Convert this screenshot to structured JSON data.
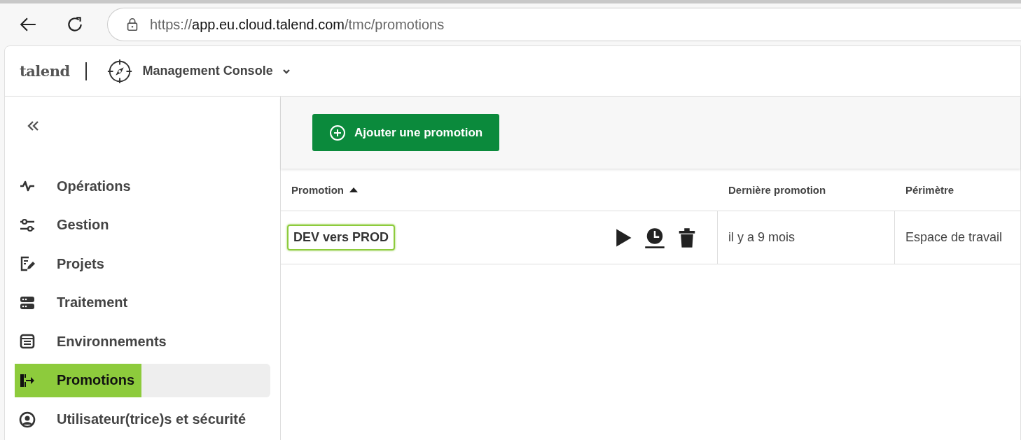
{
  "browser": {
    "url": {
      "scheme": "https://",
      "host": "app.eu.cloud.talend.com",
      "path": "/tmc/promotions"
    }
  },
  "header": {
    "logo": "talend",
    "app_name": "Management Console"
  },
  "sidebar": {
    "items": [
      {
        "label": "Opérations",
        "kind": "pulse",
        "selected": false
      },
      {
        "label": "Gestion",
        "kind": "sliders",
        "selected": false
      },
      {
        "label": "Projets",
        "kind": "edit",
        "selected": false
      },
      {
        "label": "Traitement",
        "kind": "server",
        "selected": false
      },
      {
        "label": "Environnements",
        "kind": "box",
        "selected": false
      },
      {
        "label": "Promotions",
        "kind": "promote",
        "selected": true
      },
      {
        "label": "Utilisateur(trice)s et sécurité",
        "kind": "user",
        "selected": false
      }
    ]
  },
  "toolbar": {
    "add_button": "Ajouter une promotion"
  },
  "table": {
    "columns": [
      {
        "label": "Promotion",
        "sorted": true
      },
      {
        "label": "Dernière promotion",
        "sorted": false
      },
      {
        "label": "Périmètre",
        "sorted": false
      }
    ],
    "rows": [
      {
        "name": "DEV vers PROD",
        "highlighted": true,
        "last": "il y a 9 mois",
        "scope": "Espace de travail"
      }
    ]
  }
}
